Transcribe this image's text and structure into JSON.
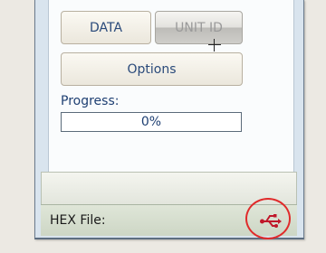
{
  "buttons": {
    "data_label": "DATA",
    "unit_id_label": "UNIT ID",
    "options_label": "Options"
  },
  "progress": {
    "label": "Progress:",
    "value_text": "0%",
    "fraction": 0
  },
  "statusbar": {
    "hex_file_label": "HEX File:",
    "icon": "usb-icon"
  },
  "colors": {
    "annotation_circle": "#e02b2b",
    "usb_icon": "#c0182a"
  }
}
